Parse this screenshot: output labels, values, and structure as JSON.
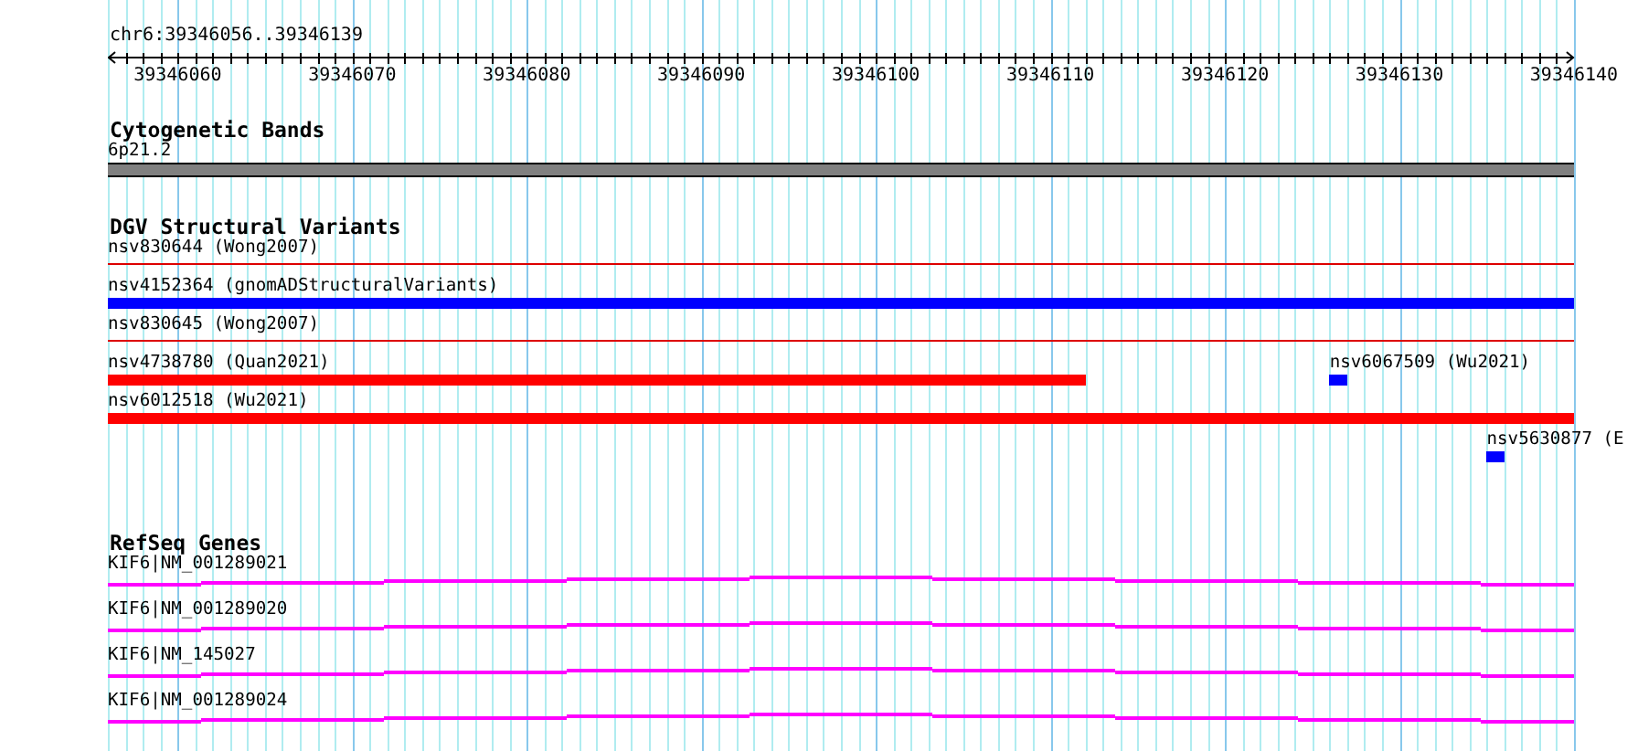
{
  "location": "chr6:39346056..39346139",
  "ruler": {
    "ticks": [
      "39346060",
      "39346070",
      "39346080",
      "39346090",
      "39346100",
      "39346110",
      "39346120",
      "39346130",
      "39346140"
    ]
  },
  "tracks": [
    {
      "title": "Cytogenetic Bands",
      "kind": "bands",
      "rows": [
        [
          {
            "label": "6p21.2",
            "kind": "bar"
          }
        ]
      ]
    },
    {
      "title": "DGV Structural Variants",
      "kind": "variants",
      "rows": [
        [
          {
            "label": "nsv830644 (Wong2007)",
            "kind": "line",
            "color": "#dd0000"
          }
        ],
        [
          {
            "label": "nsv4152364 (gnomADStructuralVariants)",
            "kind": "bar",
            "color": "#0000ff"
          }
        ],
        [
          {
            "label": "nsv830645 (Wong2007)",
            "kind": "line",
            "color": "#dd0000"
          }
        ],
        [
          {
            "label": "nsv4738780 (Quan2021)",
            "kind": "bar",
            "color": "#ff0000"
          },
          {
            "label": "nsv6067509 (Wu2021)",
            "kind": "bar",
            "color": "#0000ff"
          }
        ],
        [
          {
            "label": "nsv6012518 (Wu2021)",
            "kind": "bar",
            "color": "#ff0000"
          }
        ],
        [
          {
            "label": "nsv5630877 (E",
            "kind": "bar",
            "color": "#0000ff"
          }
        ]
      ]
    },
    {
      "title": "RefSeq Genes",
      "kind": "genes",
      "rows": [
        [
          {
            "label": "KIF6|NM_001289021",
            "kind": "gene"
          }
        ],
        [
          {
            "label": "KIF6|NM_001289020",
            "kind": "gene"
          }
        ],
        [
          {
            "label": "KIF6|NM_145027",
            "kind": "gene"
          }
        ],
        [
          {
            "label": "KIF6|NM_001289024",
            "kind": "gene"
          }
        ]
      ]
    }
  ]
}
